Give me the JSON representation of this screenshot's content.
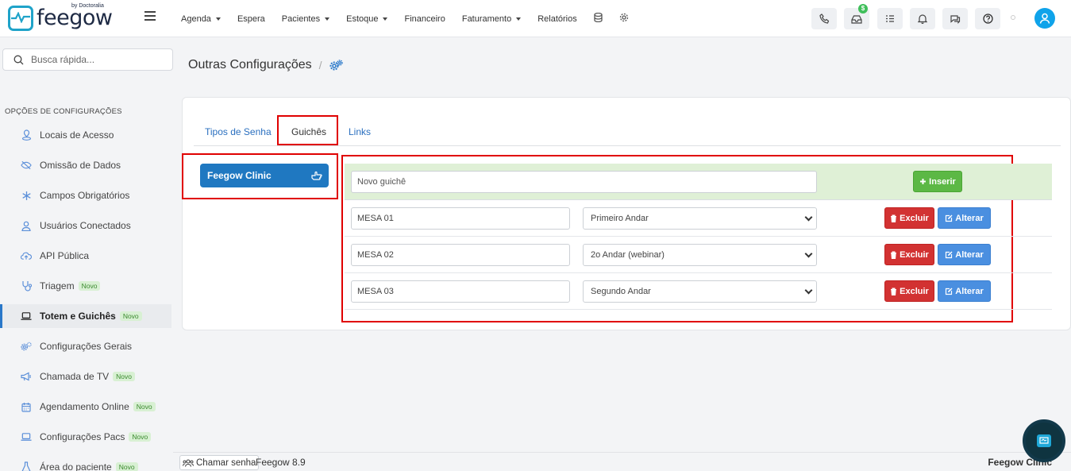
{
  "brand": {
    "name": "feegow",
    "by": "by Doctoralia"
  },
  "nav": [
    {
      "label": "Agenda",
      "dropdown": true
    },
    {
      "label": "Espera",
      "dropdown": false
    },
    {
      "label": "Pacientes",
      "dropdown": true
    },
    {
      "label": "Estoque",
      "dropdown": true
    },
    {
      "label": "Financeiro",
      "dropdown": false
    },
    {
      "label": "Faturamento",
      "dropdown": true
    },
    {
      "label": "Relatórios",
      "dropdown": false
    }
  ],
  "toolbar": {
    "inbox_badge": "$"
  },
  "search": {
    "placeholder": "Busca rápida..."
  },
  "sidebar": {
    "header": "OPÇÕES DE CONFIGURAÇÕES",
    "new_label": "Novo",
    "items": [
      {
        "label": "Locais de Acesso",
        "icon": "location-icon",
        "new": false,
        "active": false
      },
      {
        "label": "Omissão de Dados",
        "icon": "eye-off-icon",
        "new": false,
        "active": false
      },
      {
        "label": "Campos Obrigatórios",
        "icon": "asterisk-icon",
        "new": false,
        "active": false
      },
      {
        "label": "Usuários Conectados",
        "icon": "user-icon",
        "new": false,
        "active": false
      },
      {
        "label": "API Pública",
        "icon": "cloud-upload-icon",
        "new": false,
        "active": false
      },
      {
        "label": "Triagem",
        "icon": "stethoscope-icon",
        "new": true,
        "active": false
      },
      {
        "label": "Totem e Guichês",
        "icon": "laptop-icon",
        "new": true,
        "active": true
      },
      {
        "label": "Configurações Gerais",
        "icon": "gears-icon",
        "new": false,
        "active": false
      },
      {
        "label": "Chamada de TV",
        "icon": "megaphone-icon",
        "new": true,
        "active": false
      },
      {
        "label": "Agendamento Online",
        "icon": "calendar-icon",
        "new": true,
        "active": false
      },
      {
        "label": "Configurações Pacs",
        "icon": "laptop-icon",
        "new": true,
        "active": false
      },
      {
        "label": "Área do paciente",
        "icon": "flask-icon",
        "new": true,
        "active": false
      }
    ]
  },
  "page": {
    "title": "Outras Configurações"
  },
  "tabs": [
    {
      "label": "Tipos de Senha",
      "active": false
    },
    {
      "label": "Guichês",
      "active": true
    },
    {
      "label": "Links",
      "active": false
    }
  ],
  "clinic": {
    "name": "Feegow Clinic"
  },
  "guiches": {
    "new_placeholder": "Novo guichê",
    "insert_label": "Inserir",
    "delete_label": "Excluir",
    "edit_label": "Alterar",
    "rows": [
      {
        "name": "MESA 01",
        "location": "Primeiro Andar"
      },
      {
        "name": "MESA 02",
        "location": "2o Andar (webinar)"
      },
      {
        "name": "MESA 03",
        "location": "Segundo Andar"
      }
    ]
  },
  "footer": {
    "call_label": "Chamar senha",
    "version": "Feegow 8.9",
    "clinic": "Feegow Clinic"
  },
  "colors": {
    "primary": "#1f78c1",
    "success": "#5cb845",
    "danger": "#d23232",
    "info": "#4a8fe0",
    "highlight": "#e00000"
  }
}
